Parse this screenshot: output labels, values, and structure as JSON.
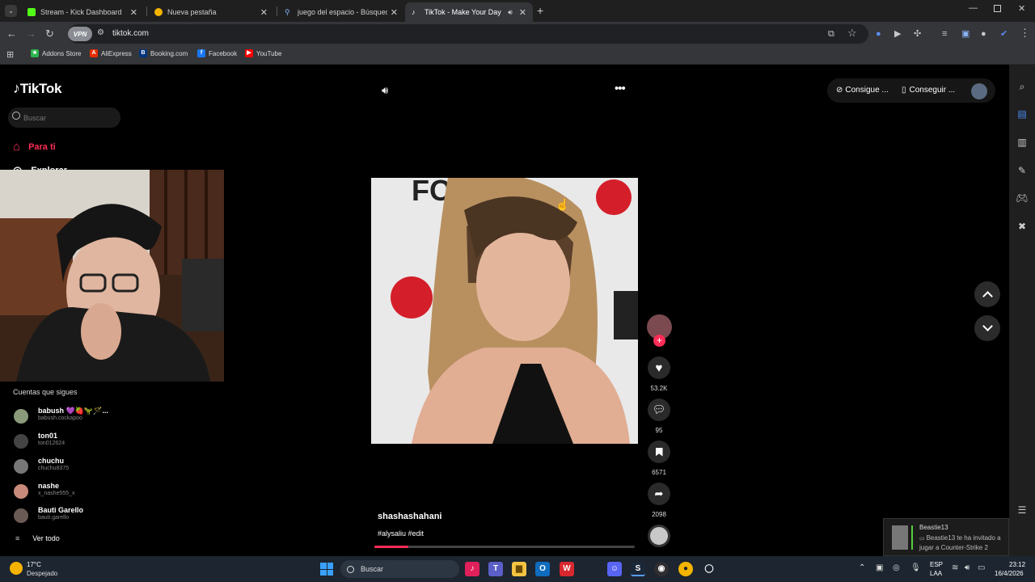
{
  "browser": {
    "tabs": [
      {
        "label": "Stream - Kick Dashboard",
        "favicon_color": "#53fc18"
      },
      {
        "label": "Nueva pestaña",
        "favicon_color": "#f4b400"
      },
      {
        "label": "juego del espacio - Búsqueda",
        "favicon_color": "#4a90e2"
      },
      {
        "label": "TikTok - Make Your Day",
        "favicon_color": "#ffffff"
      }
    ],
    "address": "tiktok.com",
    "vpn_label": "VPN",
    "bookmarks": [
      {
        "label": "Addons Store",
        "icon_color": "#2bb24c"
      },
      {
        "label": "AliExpress",
        "icon_color": "#e62e04"
      },
      {
        "label": "Booking.com",
        "icon_color": "#003580"
      },
      {
        "label": "Facebook",
        "icon_color": "#1877f2"
      },
      {
        "label": "YouTube",
        "icon_color": "#ff0000"
      }
    ]
  },
  "tiktok": {
    "logo": "TikTok",
    "search_placeholder": "Buscar",
    "nav": {
      "for_you": "Para ti",
      "explore": "Explorar"
    },
    "accent": "#fe2c55",
    "following_title": "Cuentas que sigues",
    "following": [
      {
        "name": "babush 💜🍓🦖🪄...",
        "handle": "babush.cockapoo",
        "avatar_color": "#8a9a7a"
      },
      {
        "name": "ton01",
        "handle": "ton012624",
        "avatar_color": "#444"
      },
      {
        "name": "chuchu",
        "handle": "chuchu8375",
        "avatar_color": "#777"
      },
      {
        "name": "nashe",
        "handle": "x_nashe555_x",
        "avatar_color": "#c88a7a"
      },
      {
        "name": "Bauti Garello",
        "handle": "bauti.garello",
        "avatar_color": "#6a5a55"
      }
    ],
    "see_all": "Ver todo",
    "top_actions": {
      "coins": "Consigue ...",
      "app": "Conseguir ..."
    },
    "video": {
      "author": "shashashahani",
      "hashtags": "#alysaliu #edit",
      "likes": "53.2K",
      "comments": "95",
      "saves": "6571",
      "shares": "2098",
      "progress": 0.13
    }
  },
  "toast": {
    "title": "Beastie13",
    "message": "Beastie13 te ha invitado a jugar a Counter-Strike 2"
  },
  "taskbar": {
    "weather_temp": "17°C",
    "weather_desc": "Despejado",
    "search_label": "Buscar",
    "lang_top": "ESP",
    "lang_bottom": "LAA",
    "time": "23:12",
    "date": "16/4/2026"
  }
}
